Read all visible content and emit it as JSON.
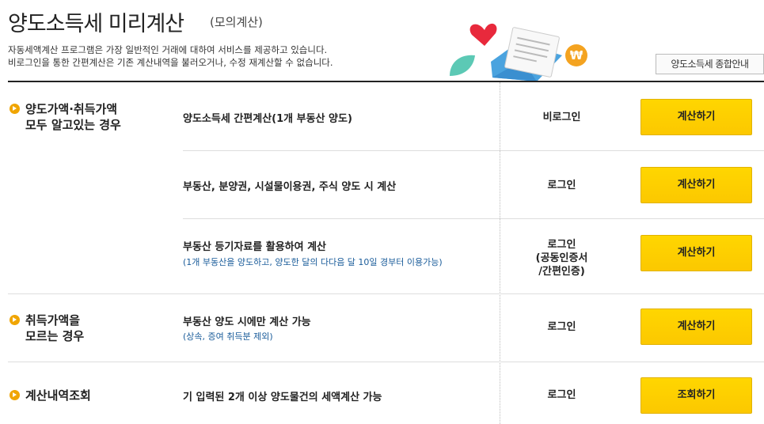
{
  "header": {
    "title": "양도소득세 미리계산",
    "subtitle": "(모의계산)",
    "desc_line1": "자동세액계산 프로그램은 가장 일반적인 거래에 대하여 서비스를 제공하고 있습니다.",
    "desc_line2": "비로그인을 통한 간편계산은 기존 계산내역을 불러오거나, 수정 재계산할 수 없습니다.",
    "guide_button": "양도소득세 종합안내"
  },
  "sections": [
    {
      "label_line1": "양도가액·취득가액",
      "label_line2": "모두 알고있는 경우",
      "items": [
        {
          "title": "양도소득세 간편계산(1개 부동산 양도)",
          "note": "",
          "login": "비로그인",
          "button": "계산하기"
        },
        {
          "title": "부동산, 분양권, 시설물이용권, 주식 양도 시 계산",
          "note": "",
          "login": "로그인",
          "button": "계산하기"
        },
        {
          "title": "부동산 등기자료를 활용하여 계산",
          "note": "(1개 부동산을 양도하고, 양도한 달의 다다음 달 10일 경부터 이용가능)",
          "login_line1": "로그인",
          "login_line2": "(공동인증서",
          "login_line3": "/간편인증)",
          "button": "계산하기"
        }
      ]
    },
    {
      "label_line1": "취득가액을",
      "label_line2": "모르는 경우",
      "items": [
        {
          "title": "부동산 양도 시에만 계산 가능",
          "note": "(상속, 증여 취득분 제외)",
          "login": "로그인",
          "button": "계산하기"
        }
      ]
    },
    {
      "label_line1": "계산내역조회",
      "items": [
        {
          "title": "기 입력된 2개 이상 양도물건의 세액계산 가능",
          "note": "",
          "login": "로그인",
          "button": "조회하기"
        }
      ]
    }
  ],
  "colors": {
    "button_yellow": "#fcc800",
    "bullet_orange": "#f0a500",
    "note_blue": "#1a5c9a"
  }
}
